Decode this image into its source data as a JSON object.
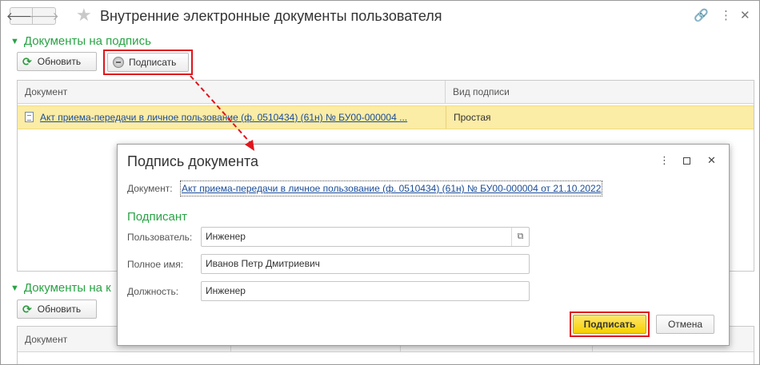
{
  "window": {
    "title": "Внутренние электронные документы пользователя",
    "back_icon": "arrow-left-icon",
    "forward_icon": "arrow-right-icon"
  },
  "group1": {
    "title": "Документы на подпись",
    "refresh_label": "Обновить",
    "sign_label": "Подписать",
    "columns": [
      "Документ",
      "Вид подписи"
    ],
    "rows": [
      {
        "document": "Акт приема-передачи в личное пользование (ф. 0510434) (61н) № БУ00-000004 ...",
        "signature_type": "Простая"
      }
    ]
  },
  "group2": {
    "title": "Документы на к",
    "refresh_label": "Обновить",
    "columns": [
      "Документ"
    ]
  },
  "dialog": {
    "title": "Подпись документа",
    "document_label": "Документ:",
    "document_link": "Акт приема-передачи в личное пользование (ф. 0510434) (61н) № БУ00-000004 от 21.10.2022",
    "section_title": "Подписант",
    "user_label": "Пользователь:",
    "user_value": "Инженер",
    "fullname_label": "Полное имя:",
    "fullname_value": "Иванов Петр Дмитриевич",
    "position_label": "Должность:",
    "position_value": "Инженер",
    "sign_button": "Подписать",
    "cancel_button": "Отмена"
  },
  "colors": {
    "accent_green": "#29a345",
    "highlight_row": "#fbeca6",
    "primary_button": "#f7d100",
    "annotation_red": "#e0151c",
    "link_blue": "#1a4c9a"
  }
}
